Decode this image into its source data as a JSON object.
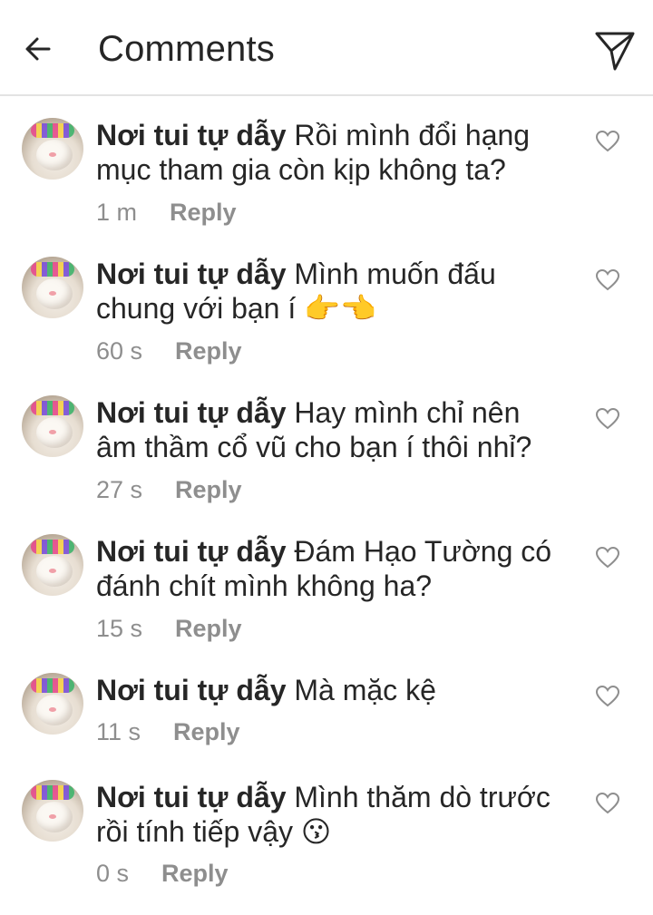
{
  "header": {
    "title": "Comments",
    "back_icon": "arrow-left-icon",
    "share_icon": "paper-plane-icon"
  },
  "colors": {
    "text": "#262626",
    "muted": "#8e8e8e",
    "divider": "#e3e3e3"
  },
  "comments": [
    {
      "username": "Nơi tui tự dẫy",
      "line1": "Rồi mình đổi hạng",
      "line2": "mục tham gia còn kịp không ta?",
      "time": "1 m",
      "reply": "Reply"
    },
    {
      "username": "Nơi tui tự dẫy",
      "line1": "Mình muốn đấu",
      "line2": "chung với bạn í 👉👈",
      "time": "60 s",
      "reply": "Reply"
    },
    {
      "username": "Nơi tui tự dẫy",
      "line1": "Hay mình chỉ nên",
      "line2": "âm thầm cổ vũ cho bạn í thôi nhỉ?",
      "time": "27 s",
      "reply": "Reply"
    },
    {
      "username": "Nơi tui tự dẫy",
      "line1": "Đám Hạo Tường có",
      "line2": "đánh chít mình không ha?",
      "time": "15 s",
      "reply": "Reply"
    },
    {
      "username": "Nơi tui tự dẫy",
      "line1": "Mà mặc kệ",
      "line2": "",
      "time": "11 s",
      "reply": "Reply"
    },
    {
      "username": "Nơi tui tự dẫy",
      "line1": "Mình thăm dò trước",
      "line2": "rồi tính tiếp vậy 😗",
      "time": "0 s",
      "reply": "Reply"
    }
  ]
}
